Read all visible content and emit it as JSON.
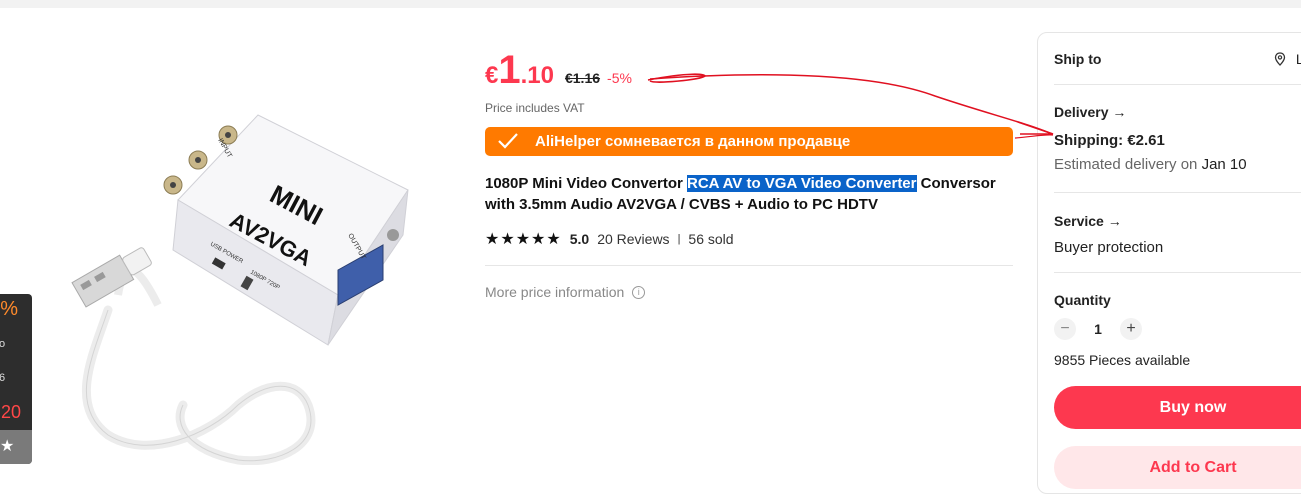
{
  "side_panel": {
    "percent": "%",
    "line_a": "o",
    "line_b": "6",
    "price": ".20",
    "star": "★"
  },
  "price": {
    "currency": "€",
    "integer": "1",
    "decimal": ".10",
    "original": "€1.16",
    "discount": "-5%",
    "vat_note": "Price includes VAT"
  },
  "alihelper": {
    "text": "AliHelper сомневается в данном продавце",
    "color": "#ff7a00"
  },
  "product": {
    "title_before": "1080P Mini Video Convertor ",
    "title_highlight": "RCA AV to VGA Video Converter",
    "title_after": " Conversor with 3.5mm Audio AV2VGA / CVBS + Audio to PC HDTV",
    "rating_stars": "★★★★★",
    "rating": "5.0",
    "reviews": "20 Reviews",
    "separator": "|",
    "sold": "56 sold",
    "more_price": "More price information",
    "info_icon": "i",
    "image_labels": {
      "brand": "MINI",
      "model": "AV2VGA",
      "input": "INPUT",
      "output": "OUTPUT",
      "usb": "USB POWER",
      "switch": "1080P 720P"
    }
  },
  "card": {
    "ship_to_label": "Ship to",
    "ship_to_value": "L",
    "location_icon": "location-pin-icon",
    "delivery_label": "Delivery →",
    "shipping": "Shipping: €2.61",
    "estimated_prefix": "Estimated delivery on ",
    "estimated_date": "Jan 10",
    "service_label": "Service →",
    "service_value": "Buyer protection",
    "quantity_label": "Quantity",
    "minus": "−",
    "quantity": "1",
    "plus": "+",
    "available": "9855 Pieces available",
    "buy_now": "Buy now",
    "add_to_cart": "Add to Cart"
  },
  "colors": {
    "accent": "#fd384f",
    "annotation": "#e01020",
    "highlight": "#0a63c9"
  }
}
